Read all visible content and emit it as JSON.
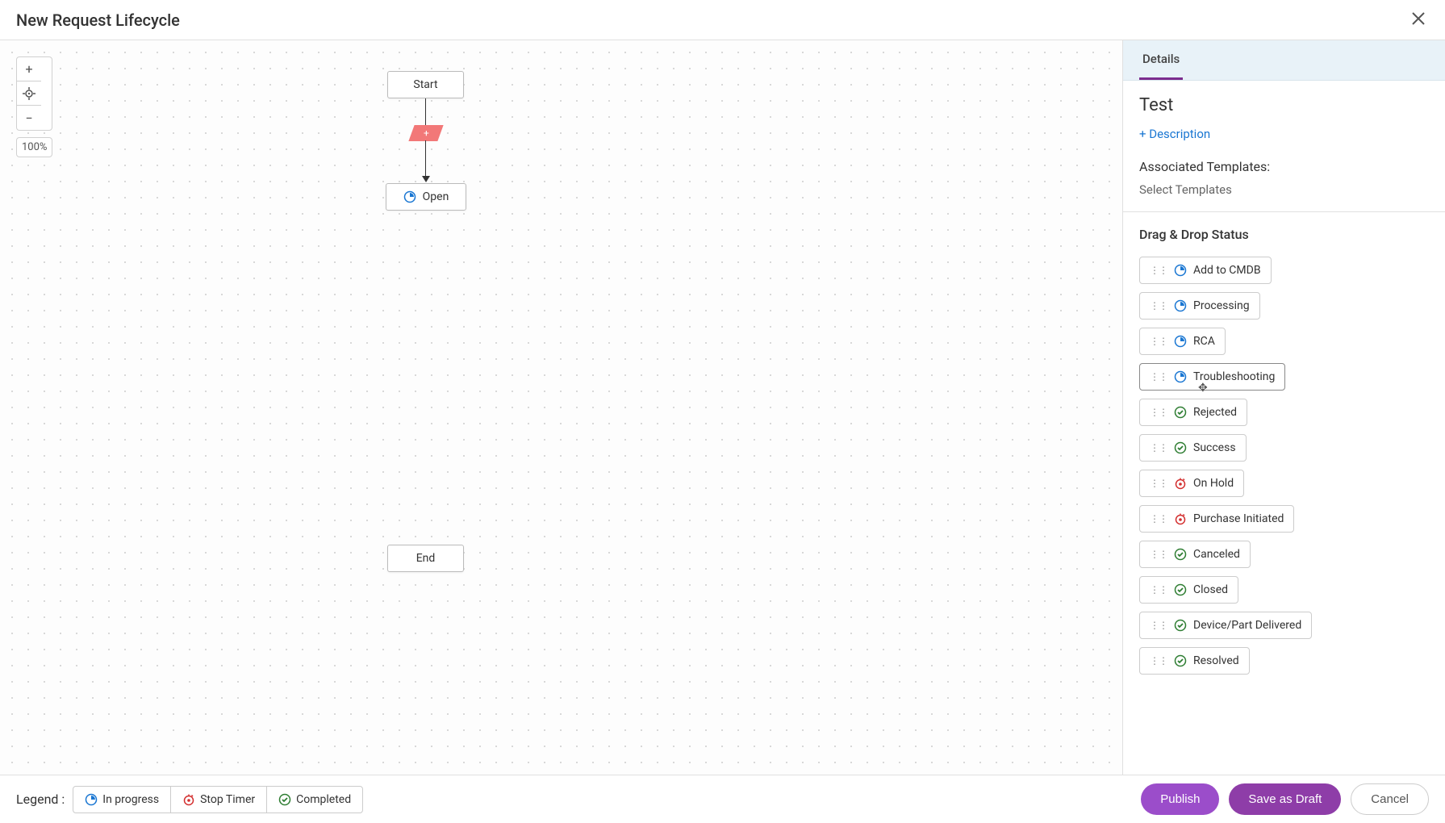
{
  "header": {
    "title": "New Request Lifecycle"
  },
  "canvas": {
    "zoom": "100%",
    "nodes": {
      "start": "Start",
      "open": "Open",
      "end": "End",
      "diamond": "+"
    }
  },
  "sidebar": {
    "tab": "Details",
    "title": "Test",
    "add_description": "+ Description",
    "associated_templates_label": "Associated Templates:",
    "select_templates": "Select Templates",
    "drag_drop_label": "Drag & Drop Status",
    "statuses": [
      {
        "label": "Add to CMDB",
        "icon": "progress"
      },
      {
        "label": "Processing",
        "icon": "progress"
      },
      {
        "label": "RCA",
        "icon": "progress"
      },
      {
        "label": "Troubleshooting",
        "icon": "progress",
        "hover": true
      },
      {
        "label": "Rejected",
        "icon": "completed"
      },
      {
        "label": "Success",
        "icon": "completed"
      },
      {
        "label": "On Hold",
        "icon": "stop"
      },
      {
        "label": "Purchase Initiated",
        "icon": "stop"
      },
      {
        "label": "Canceled",
        "icon": "completed"
      },
      {
        "label": "Closed",
        "icon": "completed"
      },
      {
        "label": "Device/Part Delivered",
        "icon": "completed"
      },
      {
        "label": "Resolved",
        "icon": "completed"
      }
    ]
  },
  "legend": {
    "label": "Legend  :",
    "items": [
      {
        "label": "In progress",
        "icon": "progress"
      },
      {
        "label": "Stop Timer",
        "icon": "stop"
      },
      {
        "label": "Completed",
        "icon": "completed"
      }
    ]
  },
  "footer": {
    "publish": "Publish",
    "save_draft": "Save as Draft",
    "cancel": "Cancel"
  }
}
